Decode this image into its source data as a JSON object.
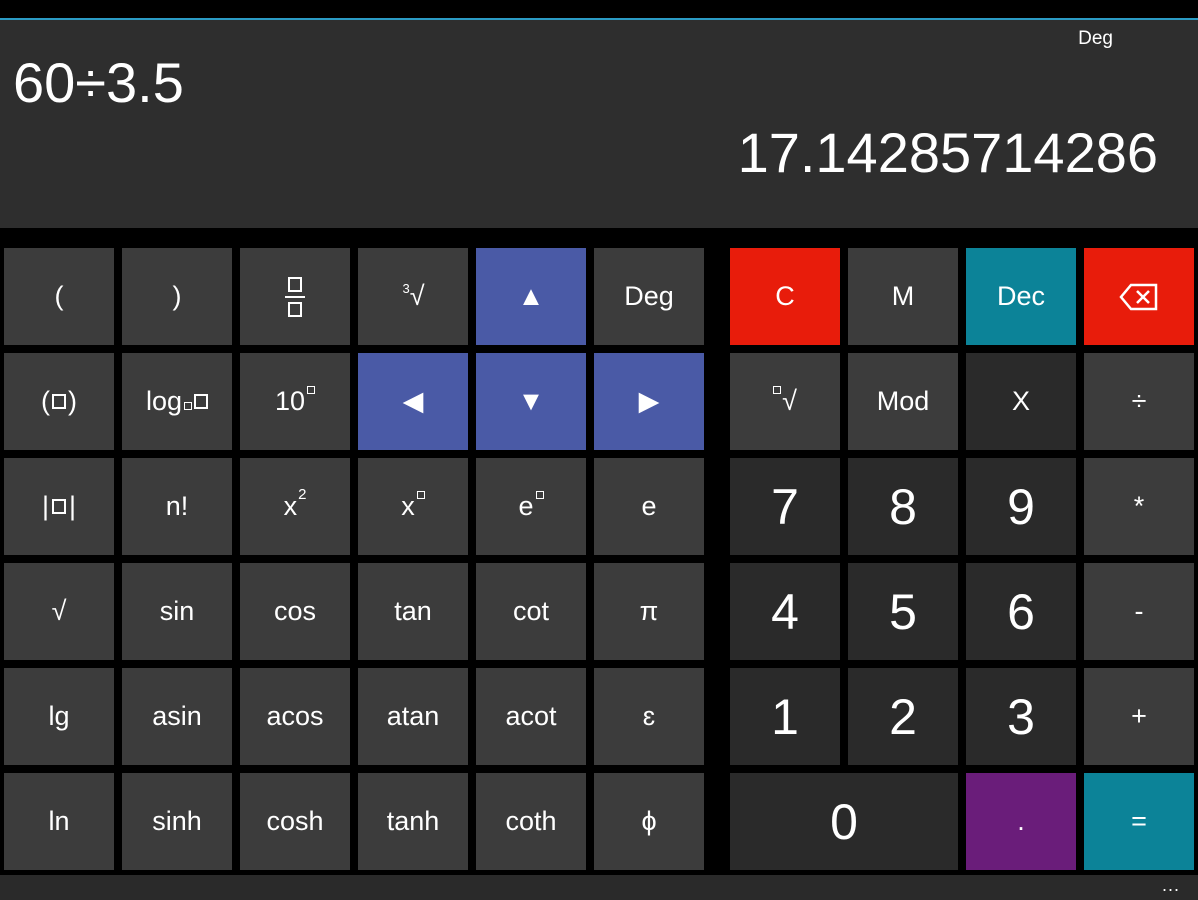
{
  "display": {
    "angle_mode": "Deg",
    "expression": "60÷3.5",
    "result": "17.14285714286"
  },
  "sci": {
    "open_paren": "(",
    "close_paren": ")",
    "cube_root": "√",
    "cube_root_index": "3",
    "deg": "Deg",
    "paren_box_open": "(",
    "paren_box_close": ")",
    "log_base": "log",
    "ten_pow_base": "10",
    "abs_left": "|",
    "abs_right": "|",
    "factorial": "n!",
    "x_sq_base": "x",
    "x_sq_exp": "2",
    "x_pow_base": "x",
    "e_pow_base": "e",
    "e_const": "e",
    "sqrt": "√",
    "sin": "sin",
    "cos": "cos",
    "tan": "tan",
    "cot": "cot",
    "pi": "π",
    "lg": "lg",
    "asin": "asin",
    "acos": "acos",
    "atan": "atan",
    "acot": "acot",
    "epsilon": "ɛ",
    "ln": "ln",
    "sinh": "sinh",
    "cosh": "cosh",
    "tanh": "tanh",
    "coth": "coth",
    "phi": "ϕ"
  },
  "nav": {
    "up": "▲",
    "left": "◀",
    "down": "▼",
    "right": "▶"
  },
  "pad": {
    "clear": "C",
    "memory": "M",
    "dec": "Dec",
    "nth_root": "√",
    "mod": "Mod",
    "x_var": "X",
    "divide": "÷",
    "multiply": "*",
    "minus": "-",
    "plus": "+",
    "equals": "=",
    "dot": ".",
    "d0": "0",
    "d1": "1",
    "d2": "2",
    "d3": "3",
    "d4": "4",
    "d5": "5",
    "d6": "6",
    "d7": "7",
    "d8": "8",
    "d9": "9"
  },
  "bottom": {
    "more": "..."
  },
  "colors": {
    "accent_line": "#2b9bc4",
    "nav_blue": "#4a5aa6",
    "clear_red": "#e81c0b",
    "dec_teal": "#0c8398",
    "dot_purple": "#6a1d7a"
  }
}
